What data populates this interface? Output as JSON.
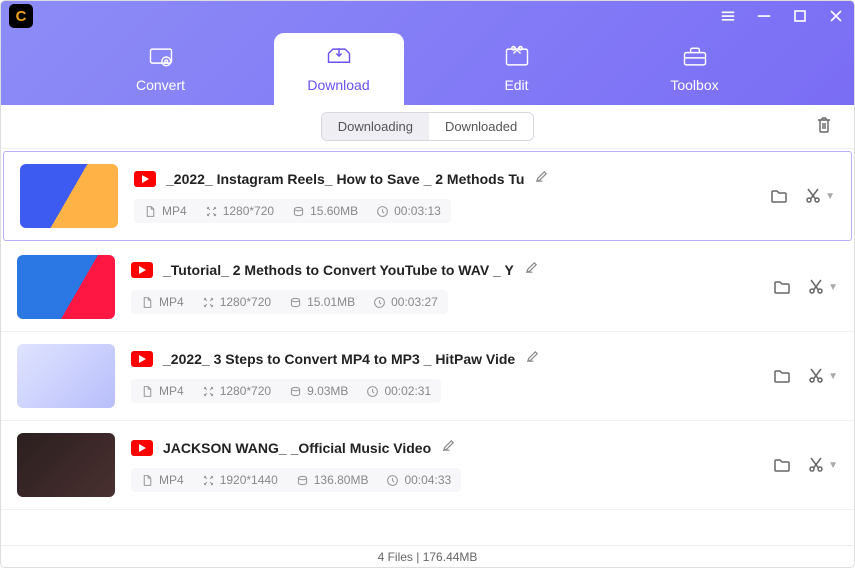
{
  "nav": [
    {
      "label": "Convert"
    },
    {
      "label": "Download"
    },
    {
      "label": "Edit"
    },
    {
      "label": "Toolbox"
    }
  ],
  "tabs": [
    "Downloading",
    "Downloaded"
  ],
  "items": [
    {
      "title": "_2022_ Instagram Reels_ How to Save _ 2 Methods Tu",
      "format": "MP4",
      "resolution": "1280*720",
      "size": "15.60MB",
      "duration": "00:03:13",
      "selected": true
    },
    {
      "title": "_Tutorial_ 2 Methods to Convert YouTube to WAV _ Y",
      "format": "MP4",
      "resolution": "1280*720",
      "size": "15.01MB",
      "duration": "00:03:27",
      "selected": false
    },
    {
      "title": "_2022_ 3 Steps to Convert MP4 to MP3 _ HitPaw Vide",
      "format": "MP4",
      "resolution": "1280*720",
      "size": "9.03MB",
      "duration": "00:02:31",
      "selected": false
    },
    {
      "title": "JACKSON WANG_ _Official Music Video",
      "format": "MP4",
      "resolution": "1920*1440",
      "size": "136.80MB",
      "duration": "00:04:33",
      "selected": false
    }
  ],
  "footer": "4 Files | 176.44MB"
}
